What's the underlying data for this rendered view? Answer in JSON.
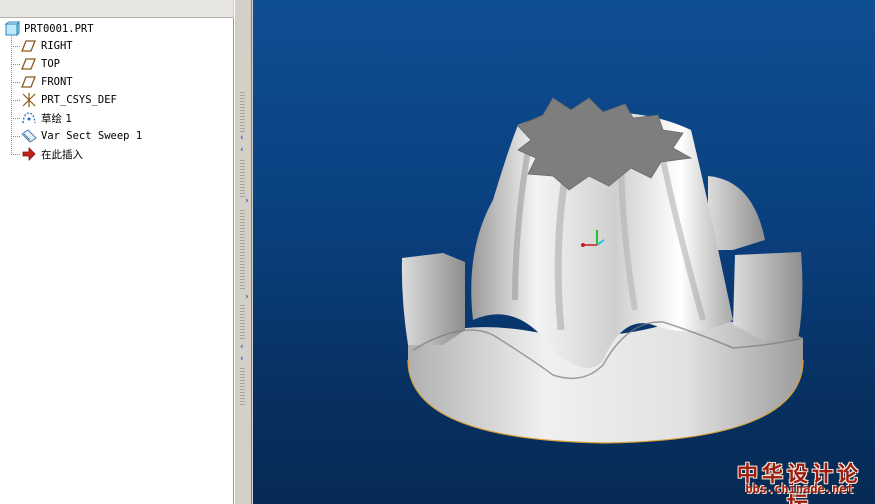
{
  "model_tree": {
    "root_label": "PRT0001.PRT",
    "items": [
      {
        "label": "RIGHT",
        "icon": "datum-plane-icon"
      },
      {
        "label": "TOP",
        "icon": "datum-plane-icon"
      },
      {
        "label": "FRONT",
        "icon": "datum-plane-icon"
      },
      {
        "label": "PRT_CSYS_DEF",
        "icon": "coordinate-system-icon"
      },
      {
        "label": "草绘 1",
        "icon": "sketch-icon"
      },
      {
        "label": "Var Sect Sweep 1",
        "icon": "sweep-feature-icon"
      },
      {
        "label": "在此插入",
        "icon": "insert-here-arrow-icon"
      }
    ]
  },
  "viewport": {
    "background_top": "#0e4f92",
    "background_bottom": "#062a55",
    "model_color": "#d9d9d9"
  },
  "watermark": {
    "title": "中华设计论坛",
    "url": "bbs.chinade.net"
  }
}
